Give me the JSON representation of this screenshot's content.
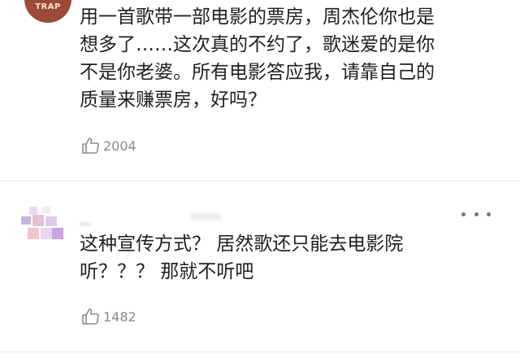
{
  "comments": [
    {
      "text": "用一首歌带一部电影的票房，周杰伦你也是\n想多了……这次真的不约了，歌迷爱的是你\n不是你老婆。所有电影答应我，请靠自己的\n质量来赚票房，好吗？",
      "likes": "2004",
      "avatar_logo": "TRAP"
    },
    {
      "text": "这种宣传方式？ 居然歌还只能去电影院\n听？？？ 那就不听吧",
      "likes": "1482"
    }
  ],
  "icons": {
    "like": "thumbs-up-icon",
    "more": "more-dots-icon"
  },
  "colors": {
    "text": "#1f1f1f",
    "meta": "#8a8a8a",
    "divider": "#e8e8e8"
  }
}
